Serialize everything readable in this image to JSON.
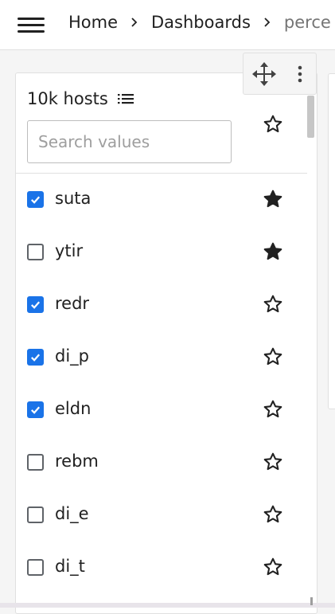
{
  "header": {
    "breadcrumb": [
      {
        "label": "Home"
      },
      {
        "label": "Dashboards"
      },
      {
        "label": "perce"
      }
    ]
  },
  "panel": {
    "title": "10k hosts",
    "search": {
      "placeholder": "Search values",
      "value": ""
    },
    "items": [
      {
        "label": "suta",
        "checked": true,
        "starred": true
      },
      {
        "label": "ytir",
        "checked": false,
        "starred": true
      },
      {
        "label": "redr",
        "checked": true,
        "starred": false
      },
      {
        "label": "di_p",
        "checked": true,
        "starred": false
      },
      {
        "label": "eldn",
        "checked": true,
        "starred": false
      },
      {
        "label": "rebm",
        "checked": false,
        "starred": false
      },
      {
        "label": "di_e",
        "checked": false,
        "starred": false
      },
      {
        "label": "di_t",
        "checked": false,
        "starred": false
      }
    ]
  },
  "colors": {
    "accent": "#1a73e8",
    "text": "#212121",
    "border": "#e0e0e0"
  },
  "icons": {
    "menu": "hamburger-menu-icon",
    "separator": "chevron-right-icon",
    "move": "move-arrows-icon",
    "more": "more-vert-icon",
    "list": "list-icon",
    "star": "star-icon"
  }
}
